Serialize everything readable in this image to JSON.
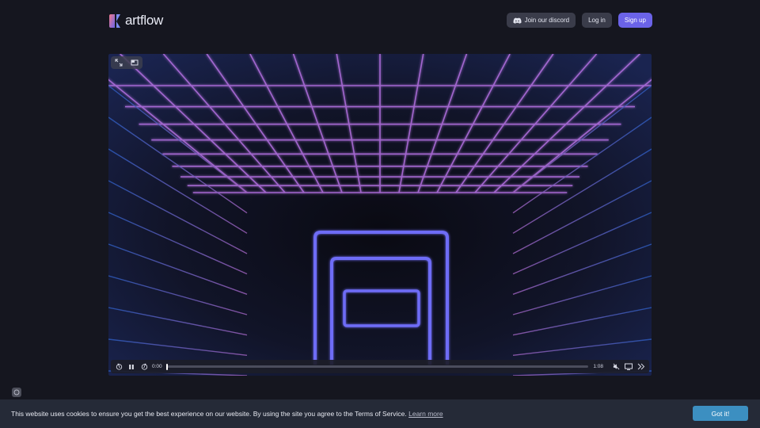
{
  "header": {
    "logo_text": "artflow",
    "discord_label": "Join our discord",
    "login_label": "Log in",
    "signup_label": "Sign up"
  },
  "player": {
    "current_time": "0:00",
    "duration": "1:08",
    "progress": 0.0
  },
  "cookie": {
    "message": "This website uses cookies to ensure you get the best experience on our website. By using the site you agree to the Terms of Service.",
    "link_label": "Learn more",
    "button_label": "Got it!"
  },
  "colors": {
    "background": "#15161f",
    "accent": "#6b63e8",
    "cookie_button": "#3c8fc1",
    "cookie_bar": "#252a37"
  },
  "icons": {
    "discord": "discord-icon",
    "fullscreen": "expand-icon",
    "pip": "picture-in-picture-icon",
    "rewind": "rewind-icon",
    "play_pause": "pause-icon",
    "forward": "forward-icon",
    "mute": "volume-muted-icon",
    "cast": "cast-icon",
    "more": "chevrons-right-icon",
    "widget": "chat-icon"
  }
}
